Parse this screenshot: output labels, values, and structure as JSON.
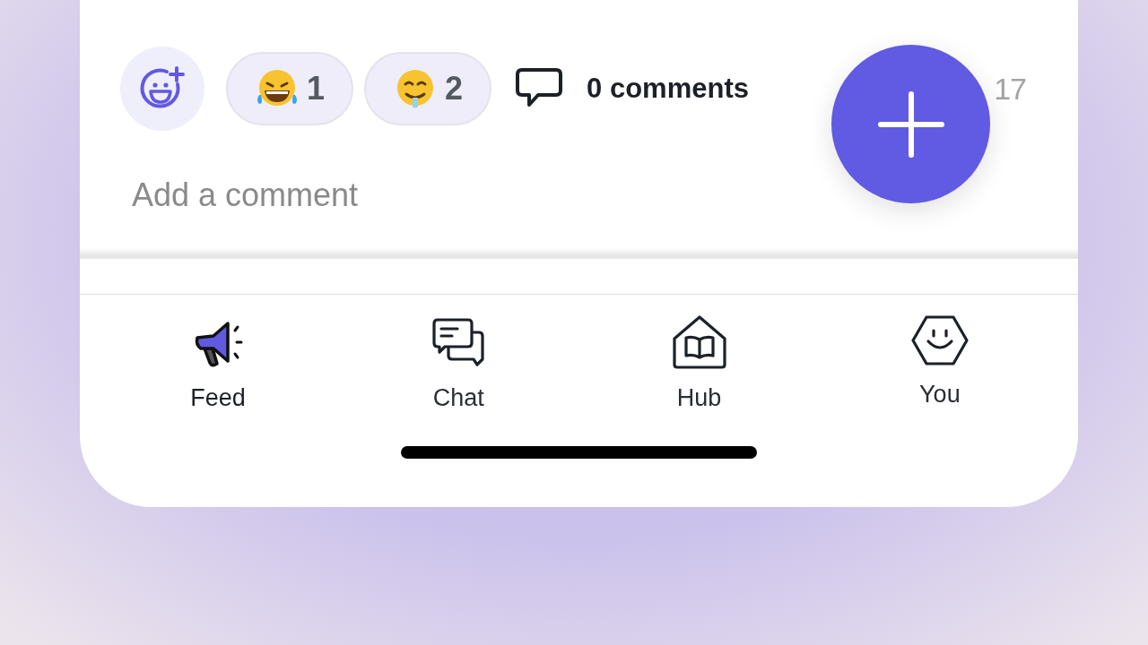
{
  "reactions": [
    {
      "kind": "laughing",
      "count": "1"
    },
    {
      "kind": "drooling",
      "count": "2"
    }
  ],
  "comments": {
    "count_label": "0 comments",
    "time": "17"
  },
  "comment_field": {
    "placeholder": "Add a comment"
  },
  "tabs": [
    {
      "label": "Feed",
      "kind": "feed",
      "selected": true
    },
    {
      "label": "Chat",
      "kind": "chat",
      "selected": false
    },
    {
      "label": "Hub",
      "kind": "hub",
      "selected": false
    },
    {
      "label": "You",
      "kind": "you",
      "selected": false
    }
  ]
}
